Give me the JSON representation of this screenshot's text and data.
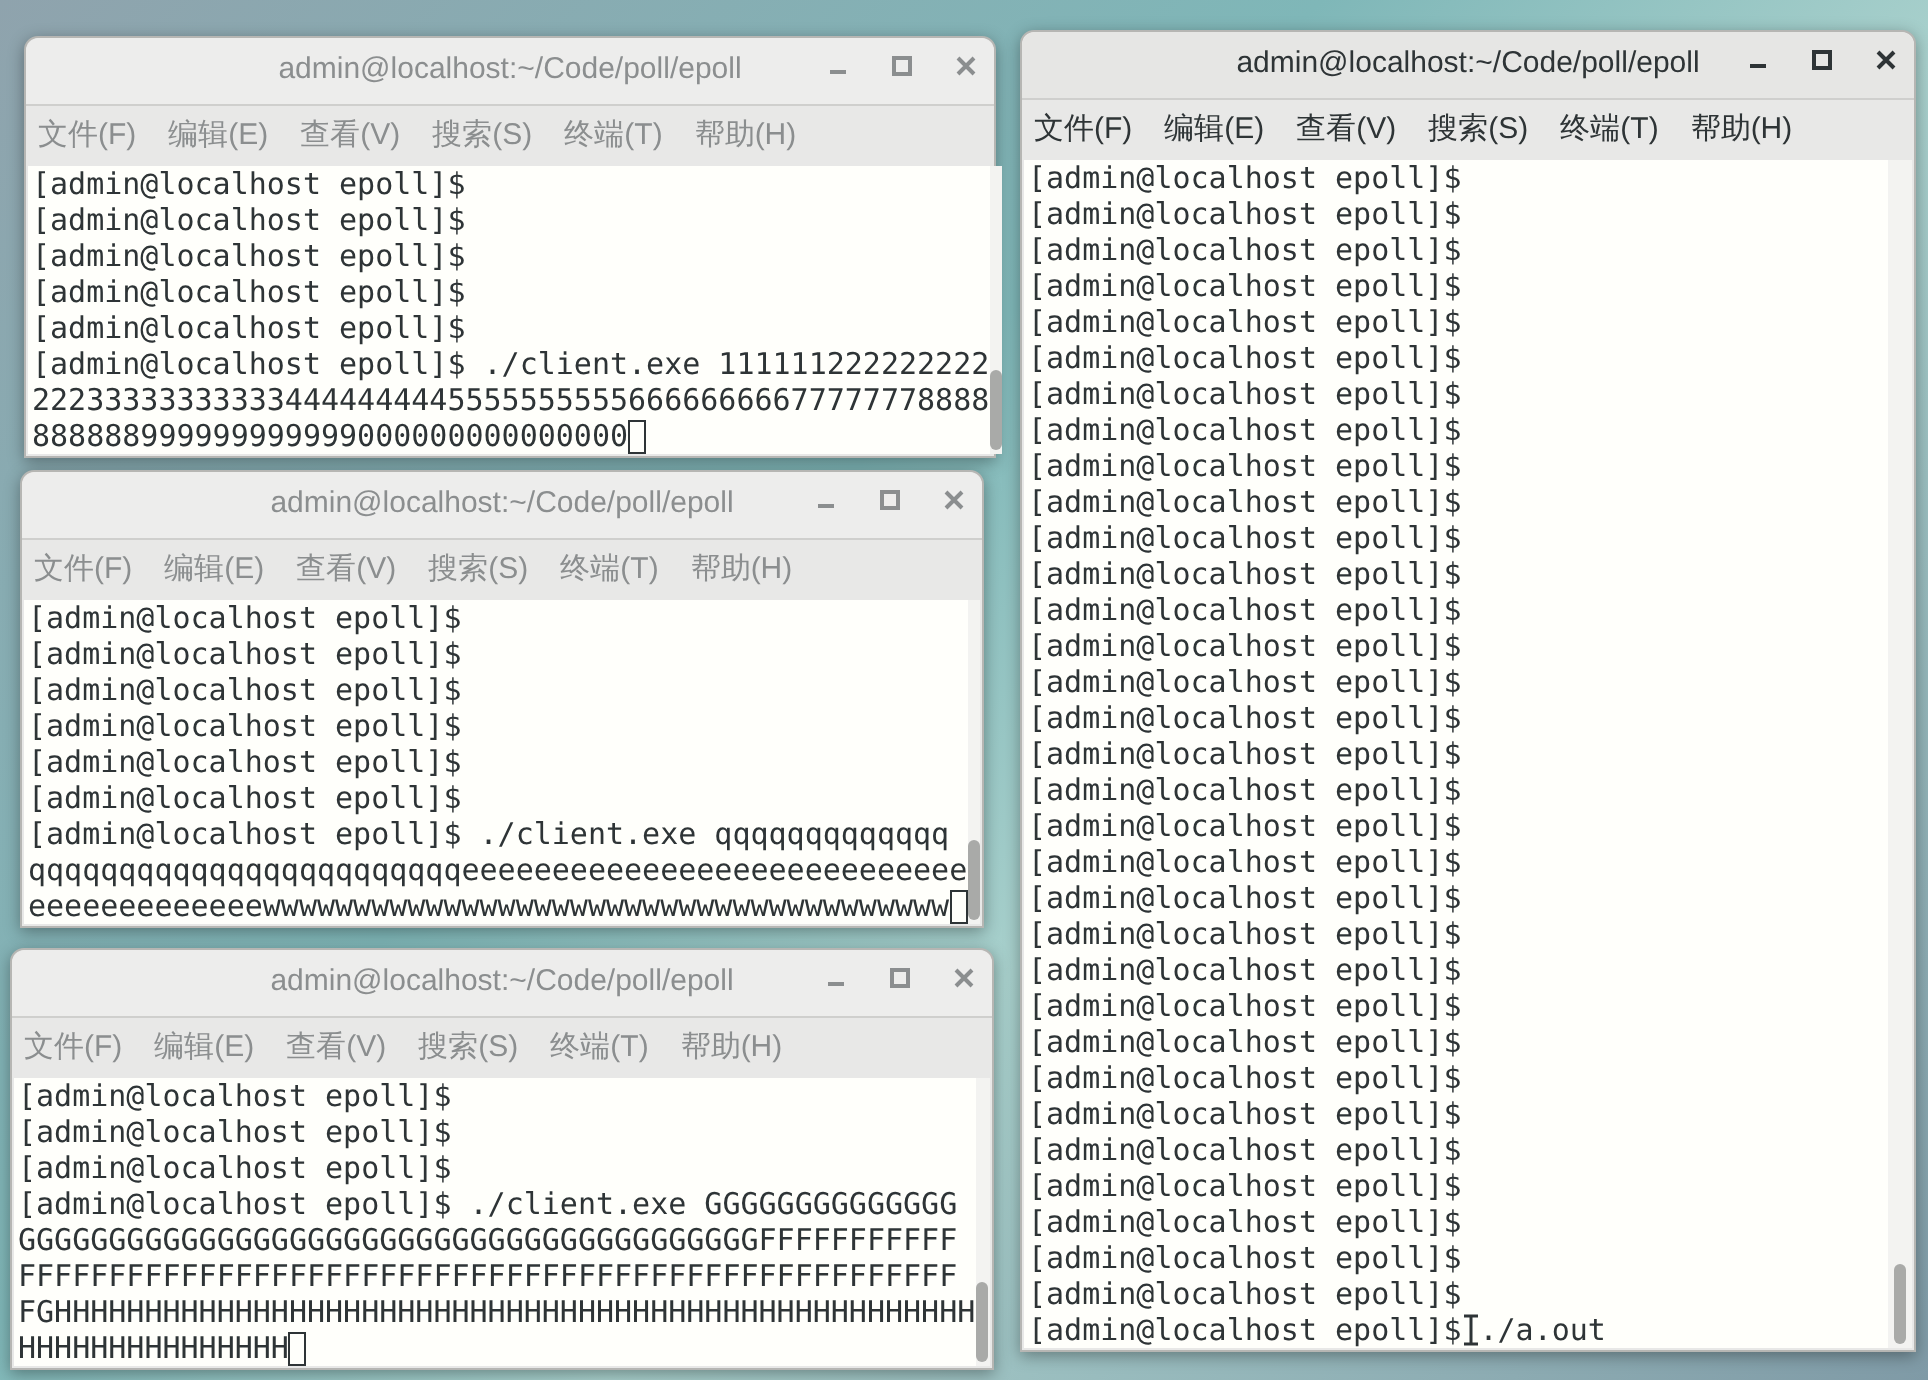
{
  "windows": [
    {
      "title": "admin@localhost:~/Code/poll/epoll",
      "active": false,
      "cursor": true,
      "menu": [
        "文件(F)",
        "编辑(E)",
        "查看(V)",
        "搜索(S)",
        "终端(T)",
        "帮助(H)"
      ],
      "lines": [
        "[admin@localhost epoll]$",
        "[admin@localhost epoll]$",
        "[admin@localhost epoll]$",
        "[admin@localhost epoll]$",
        "[admin@localhost epoll]$",
        "[admin@localhost epoll]$ ./client.exe 111111222222222",
        "22233333333333444444444555555555566666666677777778888",
        "888888999999999999000000000000000"
      ]
    },
    {
      "title": "admin@localhost:~/Code/poll/epoll",
      "active": false,
      "cursor": true,
      "menu": [
        "文件(F)",
        "编辑(E)",
        "查看(V)",
        "搜索(S)",
        "终端(T)",
        "帮助(H)"
      ],
      "lines": [
        "[admin@localhost epoll]$",
        "[admin@localhost epoll]$",
        "[admin@localhost epoll]$",
        "[admin@localhost epoll]$",
        "[admin@localhost epoll]$",
        "[admin@localhost epoll]$",
        "[admin@localhost epoll]$ ./client.exe qqqqqqqqqqqqq",
        "qqqqqqqqqqqqqqqqqqqqqqqqeeeeeeeeeeeeeeeeeeeeeeeeeeee",
        "eeeeeeeeeeeeewwwwwwwwwwwwwwwwwwwwwwwwwwwwwwwwwwwwww"
      ]
    },
    {
      "title": "admin@localhost:~/Code/poll/epoll",
      "active": false,
      "cursor": true,
      "menu": [
        "文件(F)",
        "编辑(E)",
        "查看(V)",
        "搜索(S)",
        "终端(T)",
        "帮助(H)"
      ],
      "lines": [
        "[admin@localhost epoll]$",
        "[admin@localhost epoll]$",
        "[admin@localhost epoll]$",
        "[admin@localhost epoll]$ ./client.exe GGGGGGGGGGGGGG",
        "GGGGGGGGGGGGGGGGGGGGGGGGGGGGGGGGGGGGGGGGGFFFFFFFFFFF",
        "FFFFFFFFFFFFFFFFFFFFFFFFFFFFFFFFFFFFFFFFFFFFFFFFFFFF",
        "FGHHHHHHHHHHHHHHHHHHHHHHHHHHHHHHHHHHHHHHHHHHHHHHHHHHH",
        "HHHHHHHHHHHHHHH"
      ]
    },
    {
      "title": "admin@localhost:~/Code/poll/epoll",
      "active": true,
      "cursor": false,
      "menu": [
        "文件(F)",
        "编辑(E)",
        "查看(V)",
        "搜索(S)",
        "终端(T)",
        "帮助(H)"
      ],
      "lines": [
        "[admin@localhost epoll]$",
        "[admin@localhost epoll]$",
        "[admin@localhost epoll]$",
        "[admin@localhost epoll]$",
        "[admin@localhost epoll]$",
        "[admin@localhost epoll]$",
        "[admin@localhost epoll]$",
        "[admin@localhost epoll]$",
        "[admin@localhost epoll]$",
        "[admin@localhost epoll]$",
        "[admin@localhost epoll]$",
        "[admin@localhost epoll]$",
        "[admin@localhost epoll]$",
        "[admin@localhost epoll]$",
        "[admin@localhost epoll]$",
        "[admin@localhost epoll]$",
        "[admin@localhost epoll]$",
        "[admin@localhost epoll]$",
        "[admin@localhost epoll]$",
        "[admin@localhost epoll]$",
        "[admin@localhost epoll]$",
        "[admin@localhost epoll]$",
        "[admin@localhost epoll]$",
        "[admin@localhost epoll]$",
        "[admin@localhost epoll]$",
        "[admin@localhost epoll]$",
        "[admin@localhost epoll]$",
        "[admin@localhost epoll]$",
        "[admin@localhost epoll]$",
        "[admin@localhost epoll]$",
        "[admin@localhost epoll]$",
        "[admin@localhost epoll]$",
        "[admin@localhost epoll]$"
      ],
      "input": "./a.out"
    }
  ]
}
